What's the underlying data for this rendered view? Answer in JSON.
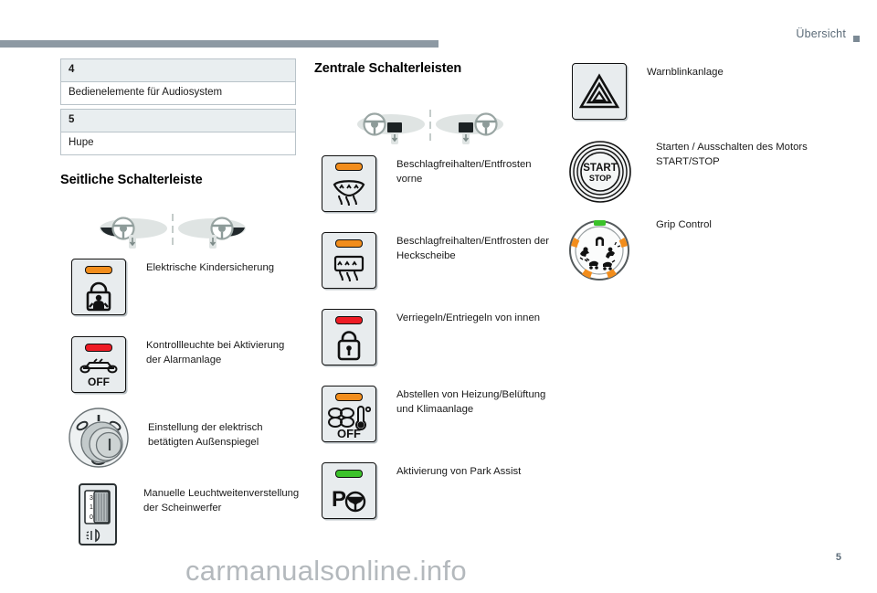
{
  "header": {
    "chapter_title": "Übersicht",
    "marker_icon": "square-marker-icon"
  },
  "footer": {
    "page_number": "5",
    "watermark": "carmanualsonline.info"
  },
  "legend_table": {
    "rows": [
      {
        "number": "4",
        "description": "Bedienelemente für Audiosystem"
      },
      {
        "number": "5",
        "description": "Hupe"
      }
    ]
  },
  "left_column": {
    "heading": "Seitliche Schalterleiste",
    "wheel_diagram": {
      "left_icon": "steering-wheel-left-hand-drive-icon",
      "right_icon": "steering-wheel-right-hand-drive-icon"
    },
    "items": [
      {
        "icon": "child-lock-icon",
        "led": "orange",
        "label": "Elektrische Kindersicherung"
      },
      {
        "icon": "alarm-off-icon",
        "led": "red",
        "label": "Kontrollleuchte bei Aktivierung der Alarmanlage",
        "glyph_text": "OFF"
      },
      {
        "icon": "mirror-adjust-dial-icon",
        "led": "none",
        "label": "Einstellung der elektrisch betätigten Außenspiegel"
      },
      {
        "icon": "headlamp-beam-height-icon",
        "led": "none",
        "label": "Manuelle Leuchtweitenverstellung der Scheinwerfer"
      }
    ]
  },
  "middle_column": {
    "heading": "Zentrale Schalterleisten",
    "wheel_diagram": {
      "left_icon": "steering-wheel-left-hand-drive-icon",
      "right_icon": "steering-wheel-right-hand-drive-icon"
    },
    "items": [
      {
        "icon": "windscreen-demist-icon",
        "led": "orange",
        "label": "Beschlagfreihalten/Entfrosten vorne"
      },
      {
        "icon": "rear-screen-demist-icon",
        "led": "orange",
        "label": "Beschlagfreihalten/Entfrosten der Heckscheibe"
      },
      {
        "icon": "central-locking-icon",
        "led": "red",
        "label": "Verriegeln/Entriegeln von innen"
      },
      {
        "icon": "climate-off-icon",
        "led": "orange",
        "label": "Abstellen von Heizung/Belüftung und Klimaanlage",
        "glyph_text": "OFF"
      },
      {
        "icon": "park-assist-icon",
        "led": "green",
        "label": "Aktivierung von Park Assist",
        "glyph_text": "P"
      }
    ]
  },
  "right_column": {
    "items": [
      {
        "icon": "hazard-warning-triangle-icon",
        "led": "none",
        "label": "Warnblinkanlage"
      },
      {
        "icon": "start-stop-button-icon",
        "led": "none",
        "label": "Starten / Ausschalten des Motors START/STOP",
        "glyph_text_primary": "START",
        "glyph_text_secondary": "STOP"
      },
      {
        "icon": "grip-control-dial-icon",
        "led": "green",
        "label": "Grip Control"
      }
    ]
  },
  "colors": {
    "led_orange": "#f28d1c",
    "led_red": "#ee1c25",
    "led_green": "#3bc22a",
    "header_bar": "#8d99a3",
    "table_head": "#e9eef0",
    "button_face": "#e8ecee"
  }
}
